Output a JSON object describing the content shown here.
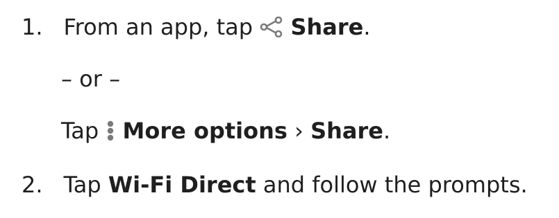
{
  "steps": {
    "step1": {
      "number": "1.",
      "text_before": "From an app, tap",
      "icon": "share-icon",
      "bold": "Share",
      "text_after": "."
    },
    "or": "– or –",
    "alt": {
      "text_before": "Tap",
      "icon": "more-options-icon",
      "bold_more": "More options",
      "separator": "›",
      "bold_share": "Share",
      "text_after": "."
    },
    "step2": {
      "number": "2.",
      "text_before": "Tap",
      "bold": "Wi-Fi Direct",
      "text_after": "and follow the prompts."
    }
  },
  "colors": {
    "text": "#1f1f1f",
    "icon": "#7a7a7a"
  }
}
